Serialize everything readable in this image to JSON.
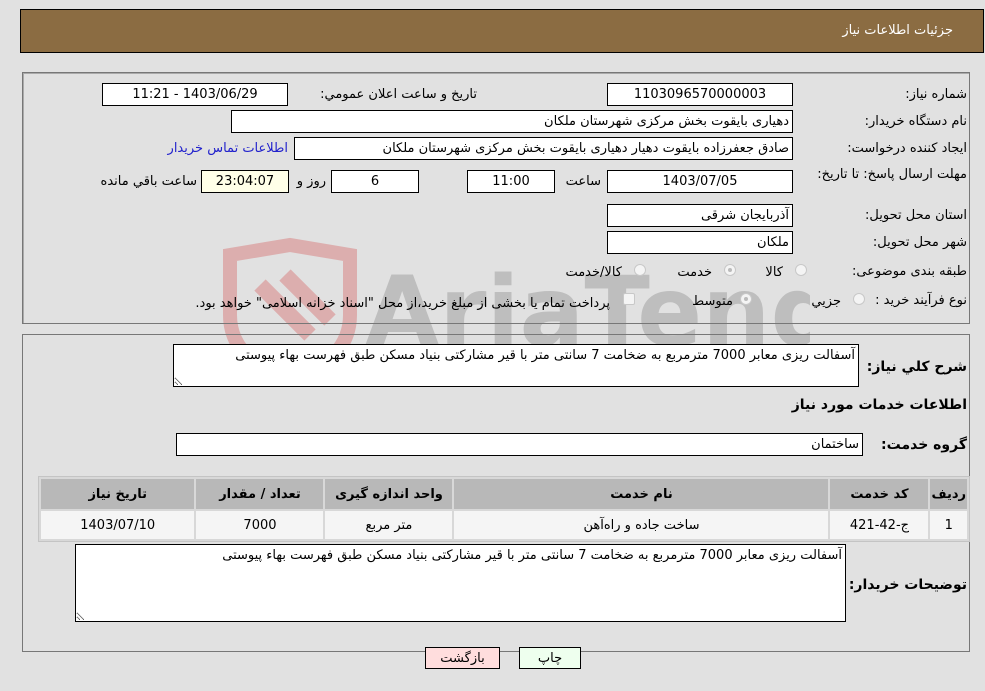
{
  "header": {
    "title": "جزئیات اطلاعات نیاز"
  },
  "fields": {
    "need_number_label": "شماره نیاز:",
    "need_number": "1103096570000003",
    "announce_label": "تاریخ و ساعت اعلان عمومي:",
    "announce_value": "1403/06/29 - 11:21",
    "buyer_org_label": "نام دستگاه خریدار:",
    "buyer_org": "دهیاری بایقوت بخش مرکزی شهرستان ملکان",
    "creator_label": "ایجاد کننده درخواست:",
    "creator": "صادق جعفرزاده بایقوت دهیار دهیاری بایقوت بخش مرکزی شهرستان ملکان",
    "contact_link": "اطلاعات تماس خریدار",
    "deadline_label": "مهلت ارسال پاسخ: تا تاریخ:",
    "deadline_date": "1403/07/05",
    "time_label": "ساعت",
    "deadline_time": "11:00",
    "days": "6",
    "days_label": "روز و",
    "remaining": "23:04:07",
    "remaining_label": "ساعت باقي مانده",
    "province_label": "استان محل تحویل:",
    "province": "آذربایجان شرقی",
    "city_label": "شهر محل تحویل:",
    "city": "ملکان",
    "category_label": "طبقه بندی موضوعی:",
    "category_options": [
      "کالا",
      "خدمت",
      "کالا/خدمت"
    ],
    "category_selected": "خدمت",
    "process_label": "نوع فرآیند خرید :",
    "process_options": [
      "جزیي",
      "متوسط"
    ],
    "process_selected": "متوسط",
    "treasury_note": "پرداخت تمام یا بخشی از مبلغ خرید،از محل \"اسناد خزانه اسلامی\" خواهد بود."
  },
  "description": {
    "label": "شرح کلي نیاز:",
    "value": "آسفالت ریزی معابر 7000 مترمربع به ضخامت 7 سانتی متر با قیر مشارکتی بنیاد مسکن طبق فهرست بهاء پیوستی"
  },
  "services": {
    "section_title": "اطلاعات خدمات مورد نیاز",
    "group_label": "گروه خدمت:",
    "group_value": "ساختمان",
    "table": {
      "headers": [
        "ردیف",
        "کد خدمت",
        "نام خدمت",
        "واحد اندازه گیری",
        "تعداد / مقدار",
        "تاریخ نیاز"
      ],
      "rows": [
        [
          "1",
          "ج-42-421",
          "ساخت جاده و راه‌آهن",
          "متر مربع",
          "7000",
          "1403/07/10"
        ]
      ]
    }
  },
  "buyer_notes": {
    "label": "توضیحات خریدار:",
    "value": "آسفالت ریزی معابر 7000 مترمربع به ضخامت 7 سانتی متر با قیر مشارکتی بنیاد مسکن طبق فهرست بهاء پیوستی"
  },
  "buttons": {
    "print": "چاپ",
    "back": "بازگشت"
  },
  "watermark": {
    "text": "AriaTender.neT"
  },
  "colors": {
    "header_bg": "#8b6c42",
    "link": "#2222cc",
    "print_bg": "#eeffee",
    "back_bg": "#ffdddd",
    "remaining_bg": "#ffffe8"
  }
}
